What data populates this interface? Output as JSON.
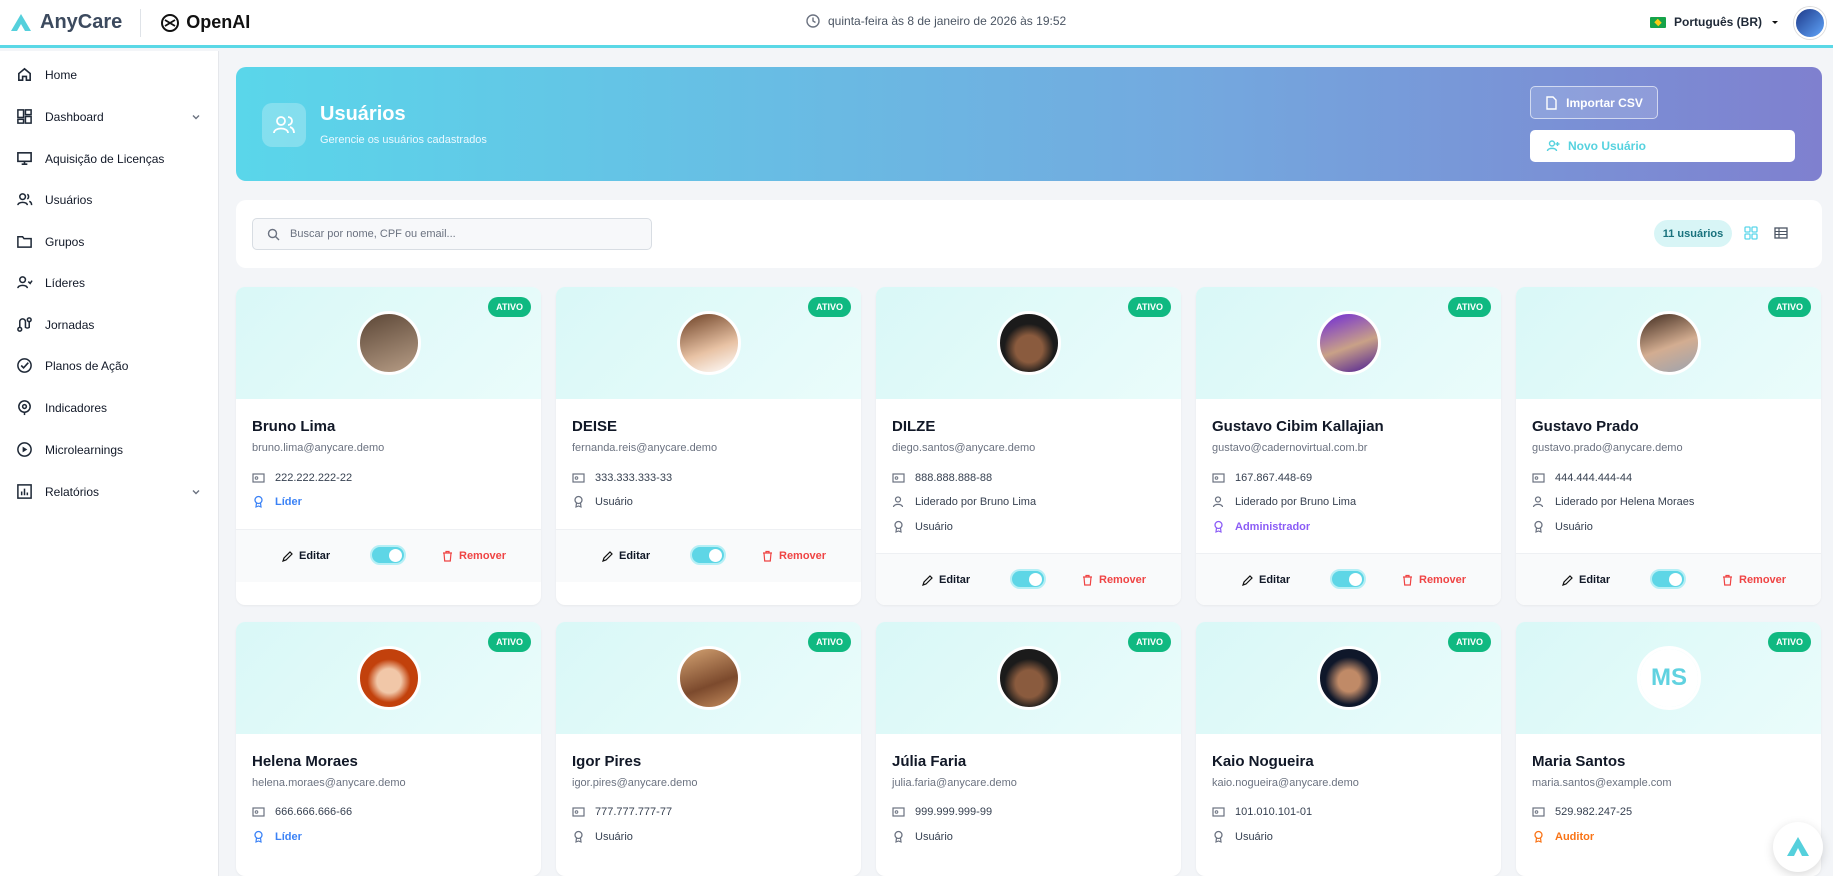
{
  "topbar": {
    "brand": "AnyCare",
    "partner": "OpenAI",
    "datetime": "quinta-feira às 8 de janeiro de 2026 às 19:52",
    "language": "Português (BR)"
  },
  "sidebar": {
    "items": [
      {
        "label": "Home",
        "icon": "home-icon"
      },
      {
        "label": "Dashboard",
        "icon": "dashboard-icon",
        "expandable": true
      },
      {
        "label": "Aquisição de Licenças",
        "icon": "monitor-icon"
      },
      {
        "label": "Usuários",
        "icon": "users-icon"
      },
      {
        "label": "Grupos",
        "icon": "folder-icon"
      },
      {
        "label": "Líderes",
        "icon": "leader-icon"
      },
      {
        "label": "Jornadas",
        "icon": "route-icon"
      },
      {
        "label": "Planos de Ação",
        "icon": "check-circle-icon"
      },
      {
        "label": "Indicadores",
        "icon": "target-icon"
      },
      {
        "label": "Microlearnings",
        "icon": "play-icon"
      },
      {
        "label": "Relatórios",
        "icon": "report-icon",
        "expandable": true
      }
    ]
  },
  "header": {
    "title": "Usuários",
    "subtitle": "Gerencie os usuários cadastrados",
    "import_label": "Importar CSV",
    "new_label": "Novo Usuário"
  },
  "filters": {
    "search_placeholder": "Buscar por nome, CPF ou email...",
    "count": "11 usuários"
  },
  "colors": {
    "accent": "#5ad6ea",
    "active_badge": "#10b981",
    "remove": "#ef4444"
  },
  "cards": [
    {
      "name": "Bruno Lima",
      "email": "bruno.lima@anycare.demo",
      "cpf": "222.222.222-22",
      "leader": "",
      "role": "Líder",
      "status": "ATIVO",
      "edit": "Editar",
      "remove": "Remover"
    },
    {
      "name": "DEISE",
      "email": "fernanda.reis@anycare.demo",
      "cpf": "333.333.333-33",
      "leader": "",
      "role": "Usuário",
      "status": "ATIVO",
      "edit": "Editar",
      "remove": "Remover"
    },
    {
      "name": "DILZE",
      "email": "diego.santos@anycare.demo",
      "cpf": "888.888.888-88",
      "leader": "Liderado por Bruno Lima",
      "role": "Usuário",
      "status": "ATIVO",
      "edit": "Editar",
      "remove": "Remover"
    },
    {
      "name": "Gustavo Cibim Kallajian",
      "email": "gustavo@cadernovirtual.com.br",
      "cpf": "167.867.448-69",
      "leader": "Liderado por Bruno Lima",
      "role": "Administrador",
      "status": "ATIVO",
      "edit": "Editar",
      "remove": "Remover"
    },
    {
      "name": "Gustavo Prado",
      "email": "gustavo.prado@anycare.demo",
      "cpf": "444.444.444-44",
      "leader": "Liderado por Helena Moraes",
      "role": "Usuário",
      "status": "ATIVO",
      "edit": "Editar",
      "remove": "Remover"
    },
    {
      "name": "Helena Moraes",
      "email": "helena.moraes@anycare.demo",
      "cpf": "666.666.666-66",
      "leader": "",
      "role": "Líder",
      "status": "ATIVO"
    },
    {
      "name": "Igor Pires",
      "email": "igor.pires@anycare.demo",
      "cpf": "777.777.777-77",
      "leader": "",
      "role": "Usuário",
      "status": "ATIVO"
    },
    {
      "name": "Júlia Faria",
      "email": "julia.faria@anycare.demo",
      "cpf": "999.999.999-99",
      "leader": "",
      "role": "Usuário",
      "status": "ATIVO"
    },
    {
      "name": "Kaio Nogueira",
      "email": "kaio.nogueira@anycare.demo",
      "cpf": "101.010.101-01",
      "leader": "",
      "role": "Usuário",
      "status": "ATIVO"
    },
    {
      "name": "Maria Santos",
      "email": "maria.santos@example.com",
      "cpf": "529.982.247-25",
      "leader": "",
      "role": "Auditor",
      "status": "ATIVO",
      "initials": "MS"
    }
  ]
}
